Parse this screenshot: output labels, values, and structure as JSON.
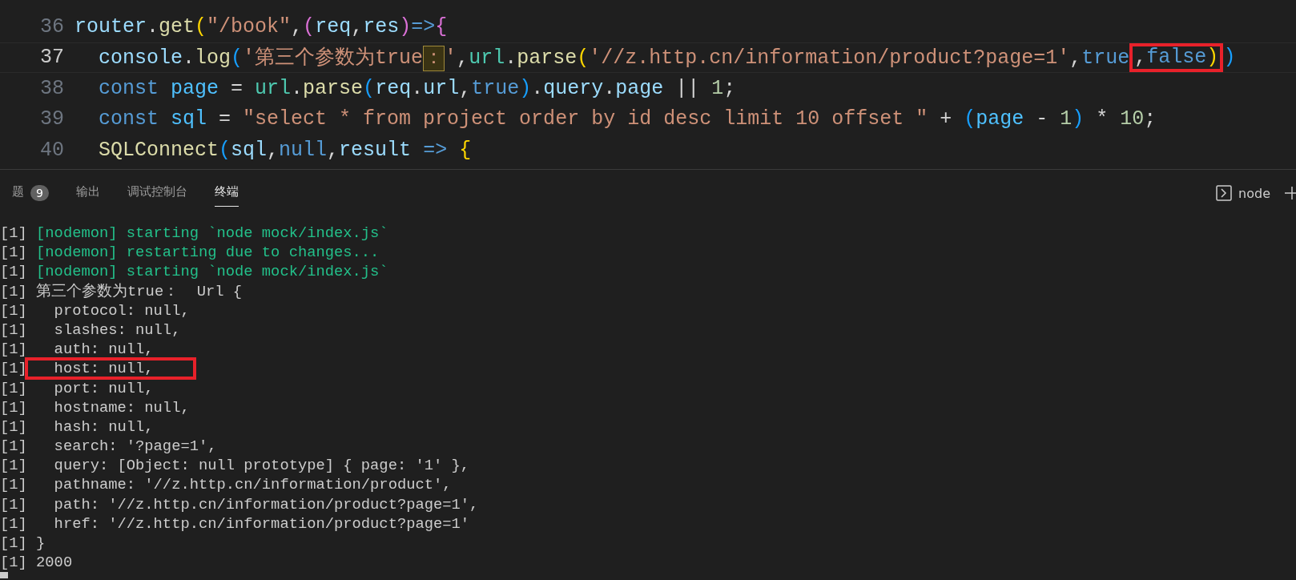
{
  "editor": {
    "lines": [
      {
        "number": "36",
        "current": false,
        "tokens": [
          {
            "kind": "var",
            "text": "router"
          },
          {
            "kind": "plain",
            "text": "."
          },
          {
            "kind": "fn",
            "text": "get"
          },
          {
            "kind": "gold",
            "text": "("
          },
          {
            "kind": "str",
            "text": "\"/book\""
          },
          {
            "kind": "plain",
            "text": ","
          },
          {
            "kind": "pink",
            "text": "("
          },
          {
            "kind": "var",
            "text": "req"
          },
          {
            "kind": "plain",
            "text": ","
          },
          {
            "kind": "var",
            "text": "res"
          },
          {
            "kind": "pink",
            "text": ")"
          },
          {
            "kind": "kw",
            "text": "=>"
          },
          {
            "kind": "pink",
            "text": "{"
          }
        ]
      },
      {
        "number": "37",
        "current": true,
        "tokens": [
          {
            "kind": "var",
            "text": "  console"
          },
          {
            "kind": "plain",
            "text": "."
          },
          {
            "kind": "fn",
            "text": "log"
          },
          {
            "kind": "blue",
            "text": "("
          },
          {
            "kind": "str",
            "text": "'第三个参数为true"
          },
          {
            "kind": "str",
            "text": "：",
            "highlighted": true
          },
          {
            "kind": "str",
            "text": "'"
          },
          {
            "kind": "plain",
            "text": ","
          },
          {
            "kind": "cls",
            "text": "url"
          },
          {
            "kind": "plain",
            "text": "."
          },
          {
            "kind": "fn",
            "text": "parse"
          },
          {
            "kind": "gold",
            "text": "("
          },
          {
            "kind": "str",
            "text": "'//z.http.cn/information/product?page=1'"
          },
          {
            "kind": "plain",
            "text": ","
          },
          {
            "kind": "kw",
            "text": "true"
          },
          {
            "kind": "plain",
            "text": ",",
            "boxed": true
          },
          {
            "kind": "kw",
            "text": "false",
            "boxed": true
          },
          {
            "kind": "gold",
            "text": ")",
            "boxed": true
          },
          {
            "kind": "blue",
            "text": ")"
          }
        ]
      },
      {
        "number": "38",
        "current": false,
        "tokens": [
          {
            "kind": "kw",
            "text": "  const "
          },
          {
            "kind": "const",
            "text": "page"
          },
          {
            "kind": "plain",
            "text": " = "
          },
          {
            "kind": "cls",
            "text": "url"
          },
          {
            "kind": "plain",
            "text": "."
          },
          {
            "kind": "fn",
            "text": "parse"
          },
          {
            "kind": "blue",
            "text": "("
          },
          {
            "kind": "var",
            "text": "req"
          },
          {
            "kind": "plain",
            "text": "."
          },
          {
            "kind": "var",
            "text": "url"
          },
          {
            "kind": "plain",
            "text": ","
          },
          {
            "kind": "kw",
            "text": "true"
          },
          {
            "kind": "blue",
            "text": ")"
          },
          {
            "kind": "plain",
            "text": "."
          },
          {
            "kind": "var",
            "text": "query"
          },
          {
            "kind": "plain",
            "text": "."
          },
          {
            "kind": "var",
            "text": "page"
          },
          {
            "kind": "plain",
            "text": " || "
          },
          {
            "kind": "num",
            "text": "1"
          },
          {
            "kind": "plain",
            "text": ";"
          }
        ]
      },
      {
        "number": "39",
        "current": false,
        "tokens": [
          {
            "kind": "kw",
            "text": "  const "
          },
          {
            "kind": "const",
            "text": "sql"
          },
          {
            "kind": "plain",
            "text": " = "
          },
          {
            "kind": "str",
            "text": "\"select * from project order by id desc limit 10 offset \""
          },
          {
            "kind": "plain",
            "text": " + "
          },
          {
            "kind": "blue",
            "text": "("
          },
          {
            "kind": "const",
            "text": "page"
          },
          {
            "kind": "plain",
            "text": " - "
          },
          {
            "kind": "num",
            "text": "1"
          },
          {
            "kind": "blue",
            "text": ")"
          },
          {
            "kind": "plain",
            "text": " * "
          },
          {
            "kind": "num",
            "text": "10"
          },
          {
            "kind": "plain",
            "text": ";"
          }
        ]
      },
      {
        "number": "40",
        "current": false,
        "tokens": [
          {
            "kind": "fn",
            "text": "  SQLConnect"
          },
          {
            "kind": "blue",
            "text": "("
          },
          {
            "kind": "var",
            "text": "sql"
          },
          {
            "kind": "plain",
            "text": ","
          },
          {
            "kind": "kw",
            "text": "null"
          },
          {
            "kind": "plain",
            "text": ","
          },
          {
            "kind": "var",
            "text": "result "
          },
          {
            "kind": "kw",
            "text": "=> "
          },
          {
            "kind": "gold",
            "text": "{"
          }
        ]
      }
    ]
  },
  "panel": {
    "tabs": [
      {
        "label": "题",
        "badge": "9",
        "selected": false
      },
      {
        "label": "输出",
        "selected": false
      },
      {
        "label": "调试控制台",
        "selected": false
      },
      {
        "label": "终端",
        "selected": true
      }
    ],
    "terminal_name": "node",
    "lines": [
      {
        "prefix": "[1]",
        "text": " [nodemon] starting `node mock/index.js`",
        "kind": "nodemon",
        "boxed": false
      },
      {
        "prefix": "[1]",
        "text": " [nodemon] restarting due to changes...",
        "kind": "nodemon",
        "boxed": false
      },
      {
        "prefix": "[1]",
        "text": " [nodemon] starting `node mock/index.js`",
        "kind": "nodemon",
        "boxed": false
      },
      {
        "prefix": "[1]",
        "text": " 第三个参数为true：  Url {",
        "kind": "output",
        "boxed": false
      },
      {
        "prefix": "[1]",
        "text": "   protocol: null,",
        "kind": "output",
        "boxed": false
      },
      {
        "prefix": "[1]",
        "text": "   slashes: null,",
        "kind": "output",
        "boxed": false
      },
      {
        "prefix": "[1]",
        "text": "   auth: null,",
        "kind": "output",
        "boxed": false
      },
      {
        "prefix": "[1]",
        "text": "   host: null,",
        "kind": "output",
        "boxed": true
      },
      {
        "prefix": "[1]",
        "text": "   port: null,",
        "kind": "output",
        "boxed": false
      },
      {
        "prefix": "[1]",
        "text": "   hostname: null,",
        "kind": "output",
        "boxed": false
      },
      {
        "prefix": "[1]",
        "text": "   hash: null,",
        "kind": "output",
        "boxed": false
      },
      {
        "prefix": "[1]",
        "text": "   search: '?page=1',",
        "kind": "output",
        "boxed": false
      },
      {
        "prefix": "[1]",
        "text": "   query: [Object: null prototype] { page: '1' },",
        "kind": "output",
        "boxed": false
      },
      {
        "prefix": "[1]",
        "text": "   pathname: '//z.http.cn/information/product',",
        "kind": "output",
        "boxed": false
      },
      {
        "prefix": "[1]",
        "text": "   path: '//z.http.cn/information/product?page=1',",
        "kind": "output",
        "boxed": false
      },
      {
        "prefix": "[1]",
        "text": "   href: '//z.http.cn/information/product?page=1'",
        "kind": "output",
        "boxed": false
      },
      {
        "prefix": "[1]",
        "text": " }",
        "kind": "output",
        "boxed": false
      },
      {
        "prefix": "[1]",
        "text": " 2000",
        "kind": "output",
        "boxed": false
      }
    ]
  }
}
